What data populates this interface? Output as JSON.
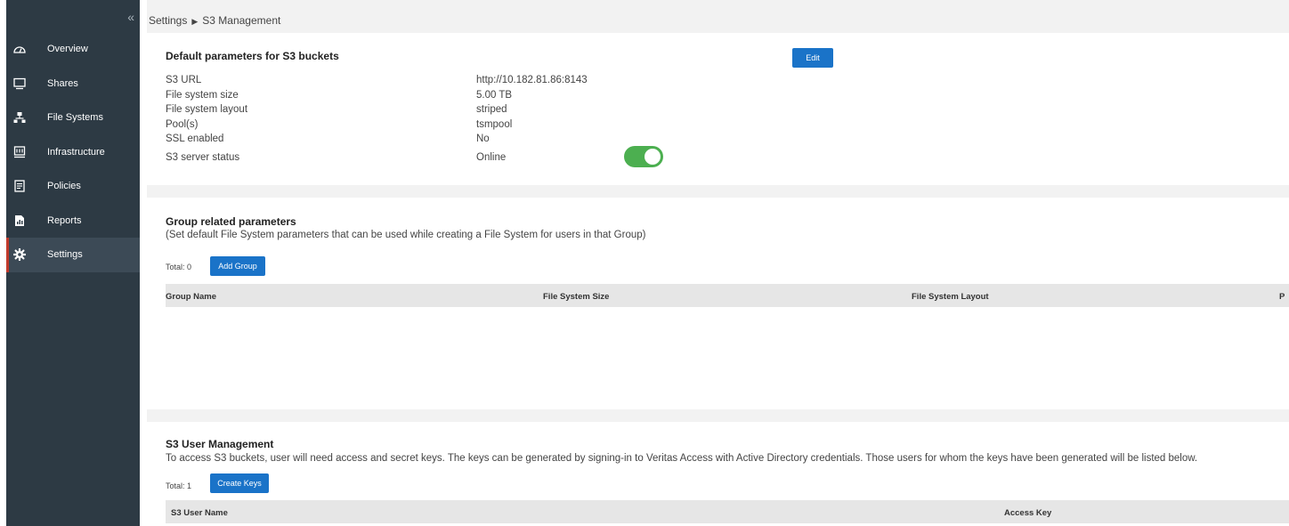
{
  "sidebar": {
    "collapse": "«",
    "items": [
      {
        "label": "Overview",
        "icon": "dashboard-icon"
      },
      {
        "label": "Shares",
        "icon": "monitor-icon"
      },
      {
        "label": "File Systems",
        "icon": "network-icon"
      },
      {
        "label": "Infrastructure",
        "icon": "server-icon"
      },
      {
        "label": "Policies",
        "icon": "document-icon"
      },
      {
        "label": "Reports",
        "icon": "report-icon"
      },
      {
        "label": "Settings",
        "icon": "gear-icon",
        "active": true
      }
    ]
  },
  "breadcrumb": {
    "parent": "Settings",
    "separator": "▶",
    "current": "S3 Management"
  },
  "defaults": {
    "title": "Default parameters for S3 buckets",
    "edit_label": "Edit",
    "rows": [
      {
        "label": "S3 URL",
        "value": "http://10.182.81.86:8143"
      },
      {
        "label": "File system size",
        "value": "5.00 TB"
      },
      {
        "label": "File system layout",
        "value": "striped"
      },
      {
        "label": "Pool(s)",
        "value": "tsmpool"
      },
      {
        "label": "SSL enabled",
        "value": "No"
      },
      {
        "label": "S3 server status",
        "value": "Online"
      }
    ],
    "server_toggle_on": true
  },
  "groups": {
    "title": "Group related parameters",
    "subtitle": "(Set default File System parameters that can be used while creating a File System for users in that Group)",
    "total": "Total: 0",
    "add_label": "Add Group",
    "columns": [
      "Group Name",
      "File System Size",
      "File System Layout",
      "P"
    ]
  },
  "users": {
    "title": "S3 User Management",
    "subtitle": "To access S3 buckets, user will need access and secret keys. The keys can be generated by signing-in to Veritas Access with Active Directory credentials. Those users for whom the keys have been generated will be listed below.",
    "total": "Total: 1",
    "create_label": "Create Keys",
    "columns": [
      "S3 User Name",
      "Access Key"
    ]
  },
  "colors": {
    "sidebar_bg": "#2d3a44",
    "accent": "#1a73c8",
    "toggle_on": "#4caf50",
    "active_marker": "#c0392b"
  }
}
